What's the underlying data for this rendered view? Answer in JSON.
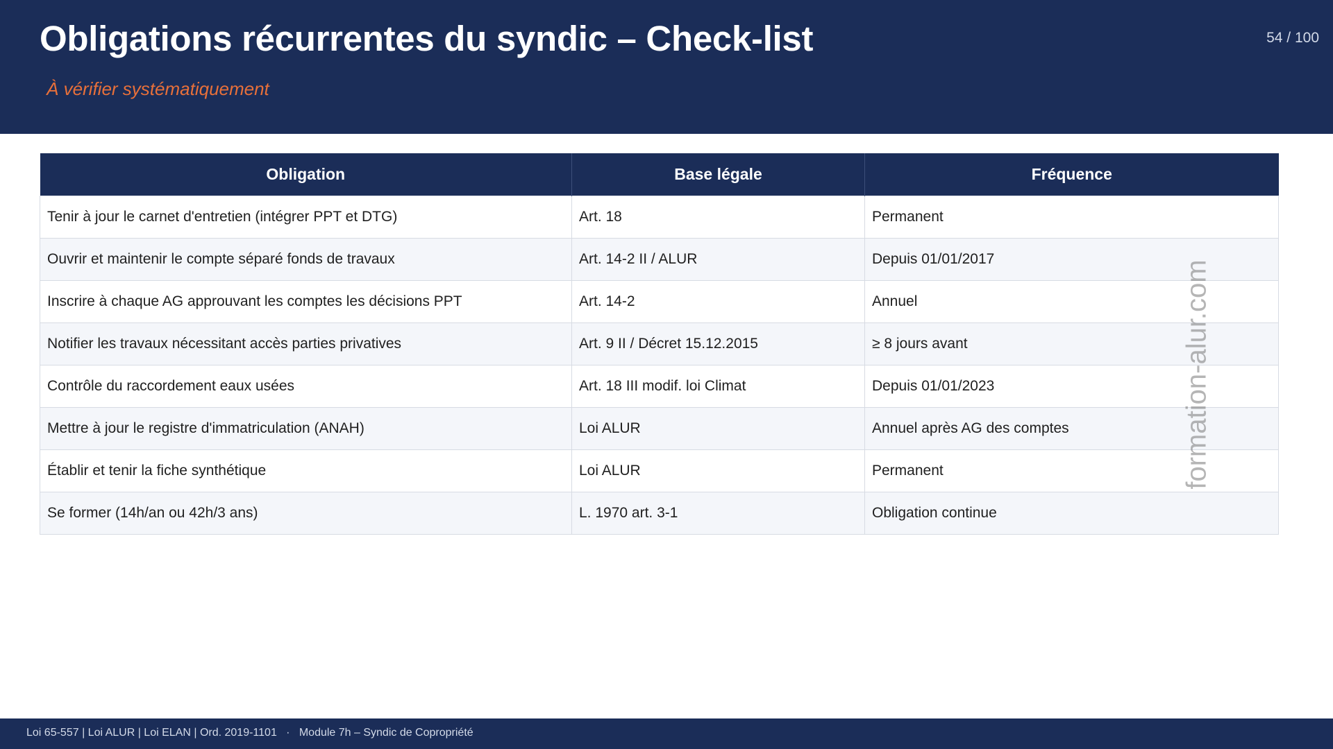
{
  "header": {
    "title": "Obligations récurrentes du syndic – Check-list",
    "subtitle": "À vérifier systématiquement",
    "page_number": "54 / 100"
  },
  "table": {
    "columns": [
      "Obligation",
      "Base légale",
      "Fréquence"
    ],
    "rows": [
      [
        "Tenir à jour le carnet d'entretien (intégrer PPT et DTG)",
        "Art. 18",
        "Permanent"
      ],
      [
        "Ouvrir et maintenir le compte séparé fonds de travaux",
        "Art. 14-2 II / ALUR",
        "Depuis 01/01/2017"
      ],
      [
        "Inscrire à chaque AG approuvant les comptes les décisions PPT",
        "Art. 14-2",
        "Annuel"
      ],
      [
        "Notifier les travaux nécessitant accès parties privatives",
        "Art. 9 II / Décret 15.12.2015",
        "≥ 8 jours avant"
      ],
      [
        "Contrôle du raccordement eaux usées",
        "Art. 18 III modif. loi Climat",
        "Depuis 01/01/2023"
      ],
      [
        "Mettre à jour le registre d'immatriculation (ANAH)",
        "Loi ALUR",
        "Annuel après AG des comptes"
      ],
      [
        "Établir et tenir la fiche synthétique",
        "Loi ALUR",
        "Permanent"
      ],
      [
        "Se former (14h/an ou 42h/3 ans)",
        "L. 1970 art. 3-1",
        "Obligation continue"
      ]
    ]
  },
  "watermark": "formation-alur.com",
  "footer": {
    "text": "Loi 65-557 | Loi ALUR | Loi ELAN | Ord. 2019-1101   ·   Module 7h – Syndic de Copropriété"
  },
  "colors": {
    "header_bg": "#1b2d58",
    "subtitle": "#e8703a",
    "row_alt_bg": "#f4f6fa"
  }
}
